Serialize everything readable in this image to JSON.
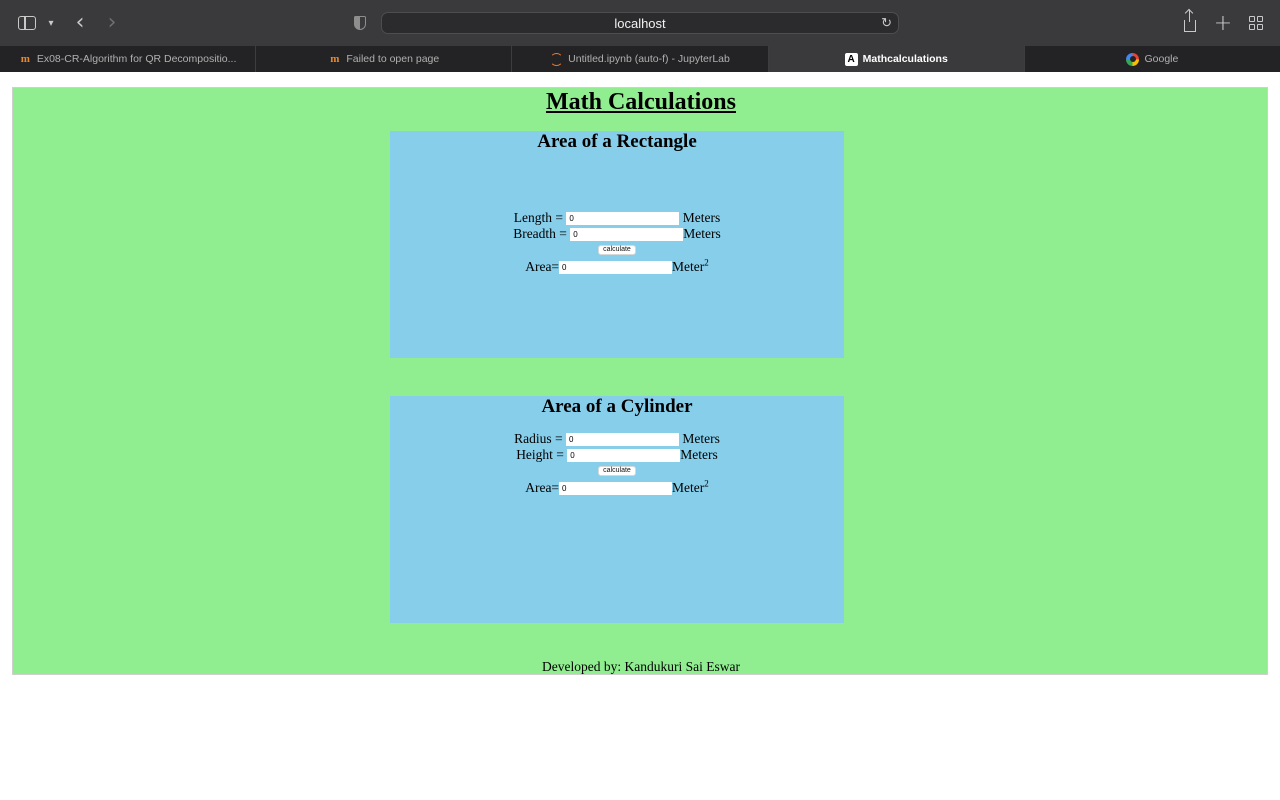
{
  "browser": {
    "address": "localhost",
    "tabs": [
      {
        "title": "Ex08-CR-Algorithm for QR Decompositio...",
        "favicon": "mooc-icon",
        "active": false
      },
      {
        "title": "Failed to open page",
        "favicon": "mooc-icon",
        "active": false
      },
      {
        "title": "Untitled.ipynb (auto-f) - JupyterLab",
        "favicon": "jupyter-icon",
        "active": false
      },
      {
        "title": "Mathcalculations",
        "favicon": "angular-icon",
        "active": true
      },
      {
        "title": "Google",
        "favicon": "google-icon",
        "active": false
      }
    ]
  },
  "page": {
    "title": "Math Calculations",
    "background_color": "#90ee90",
    "box_color": "#87ceeb",
    "rectangle": {
      "title": "Area of a Rectangle",
      "length_label": "Length = ",
      "length_value": "0",
      "length_unit": " Meters",
      "breadth_label": "Breadth = ",
      "breadth_value": "0",
      "breadth_unit": "Meters",
      "button_label": "calculate",
      "area_label": "Area=",
      "area_value": "0",
      "area_unit": "Meter",
      "area_unit_exp": "2"
    },
    "cylinder": {
      "title": "Area of a Cylinder",
      "radius_label": "Radius = ",
      "radius_value": "0",
      "radius_unit": " Meters",
      "height_label": "Height = ",
      "height_value": "0",
      "height_unit": "Meters",
      "button_label": "calculate",
      "area_label": "Area=",
      "area_value": "0",
      "area_unit": "Meter",
      "area_unit_exp": "2"
    },
    "footer": "Developed by: Kandukuri Sai Eswar"
  }
}
